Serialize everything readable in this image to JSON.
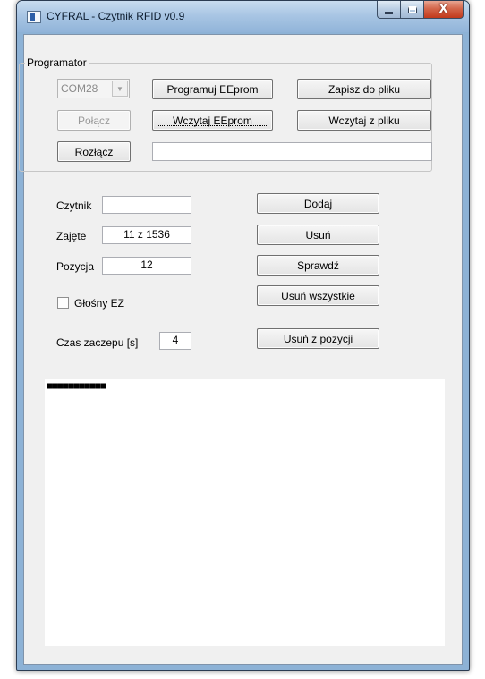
{
  "window": {
    "title": "CYFRAL - Czytnik RFID v0.9"
  },
  "caption_buttons": {
    "close_glyph": "X"
  },
  "programator": {
    "group_label": "Programator",
    "port": "COM28",
    "program_label": "Programuj EEprom",
    "save_file_label": "Zapisz do pliku",
    "connect_label": "Połącz",
    "read_eeprom_label": "Wczytaj  EEprom",
    "load_file_label": "Wczytaj z pliku",
    "disconnect_label": "Rozłącz",
    "status_value": ""
  },
  "reader": {
    "reader_label": "Czytnik",
    "reader_value": "",
    "occupied_label": "Zajęte",
    "occupied_value": "11 z 1536",
    "position_label": "Pozycja",
    "position_value": "12",
    "loud_ez_label": "Głośny EZ",
    "loud_ez_checked": false,
    "delay_label": "Czas zaczepu [s]",
    "delay_value": "4"
  },
  "actions": {
    "add_label": "Dodaj",
    "remove_label": "Usuń",
    "check_label": "Sprawdź",
    "remove_all_label": "Usuń wszystkie",
    "remove_from_position_label": "Usuń z pozycji"
  },
  "log": {
    "text": "■■■■■■■■■■■"
  }
}
